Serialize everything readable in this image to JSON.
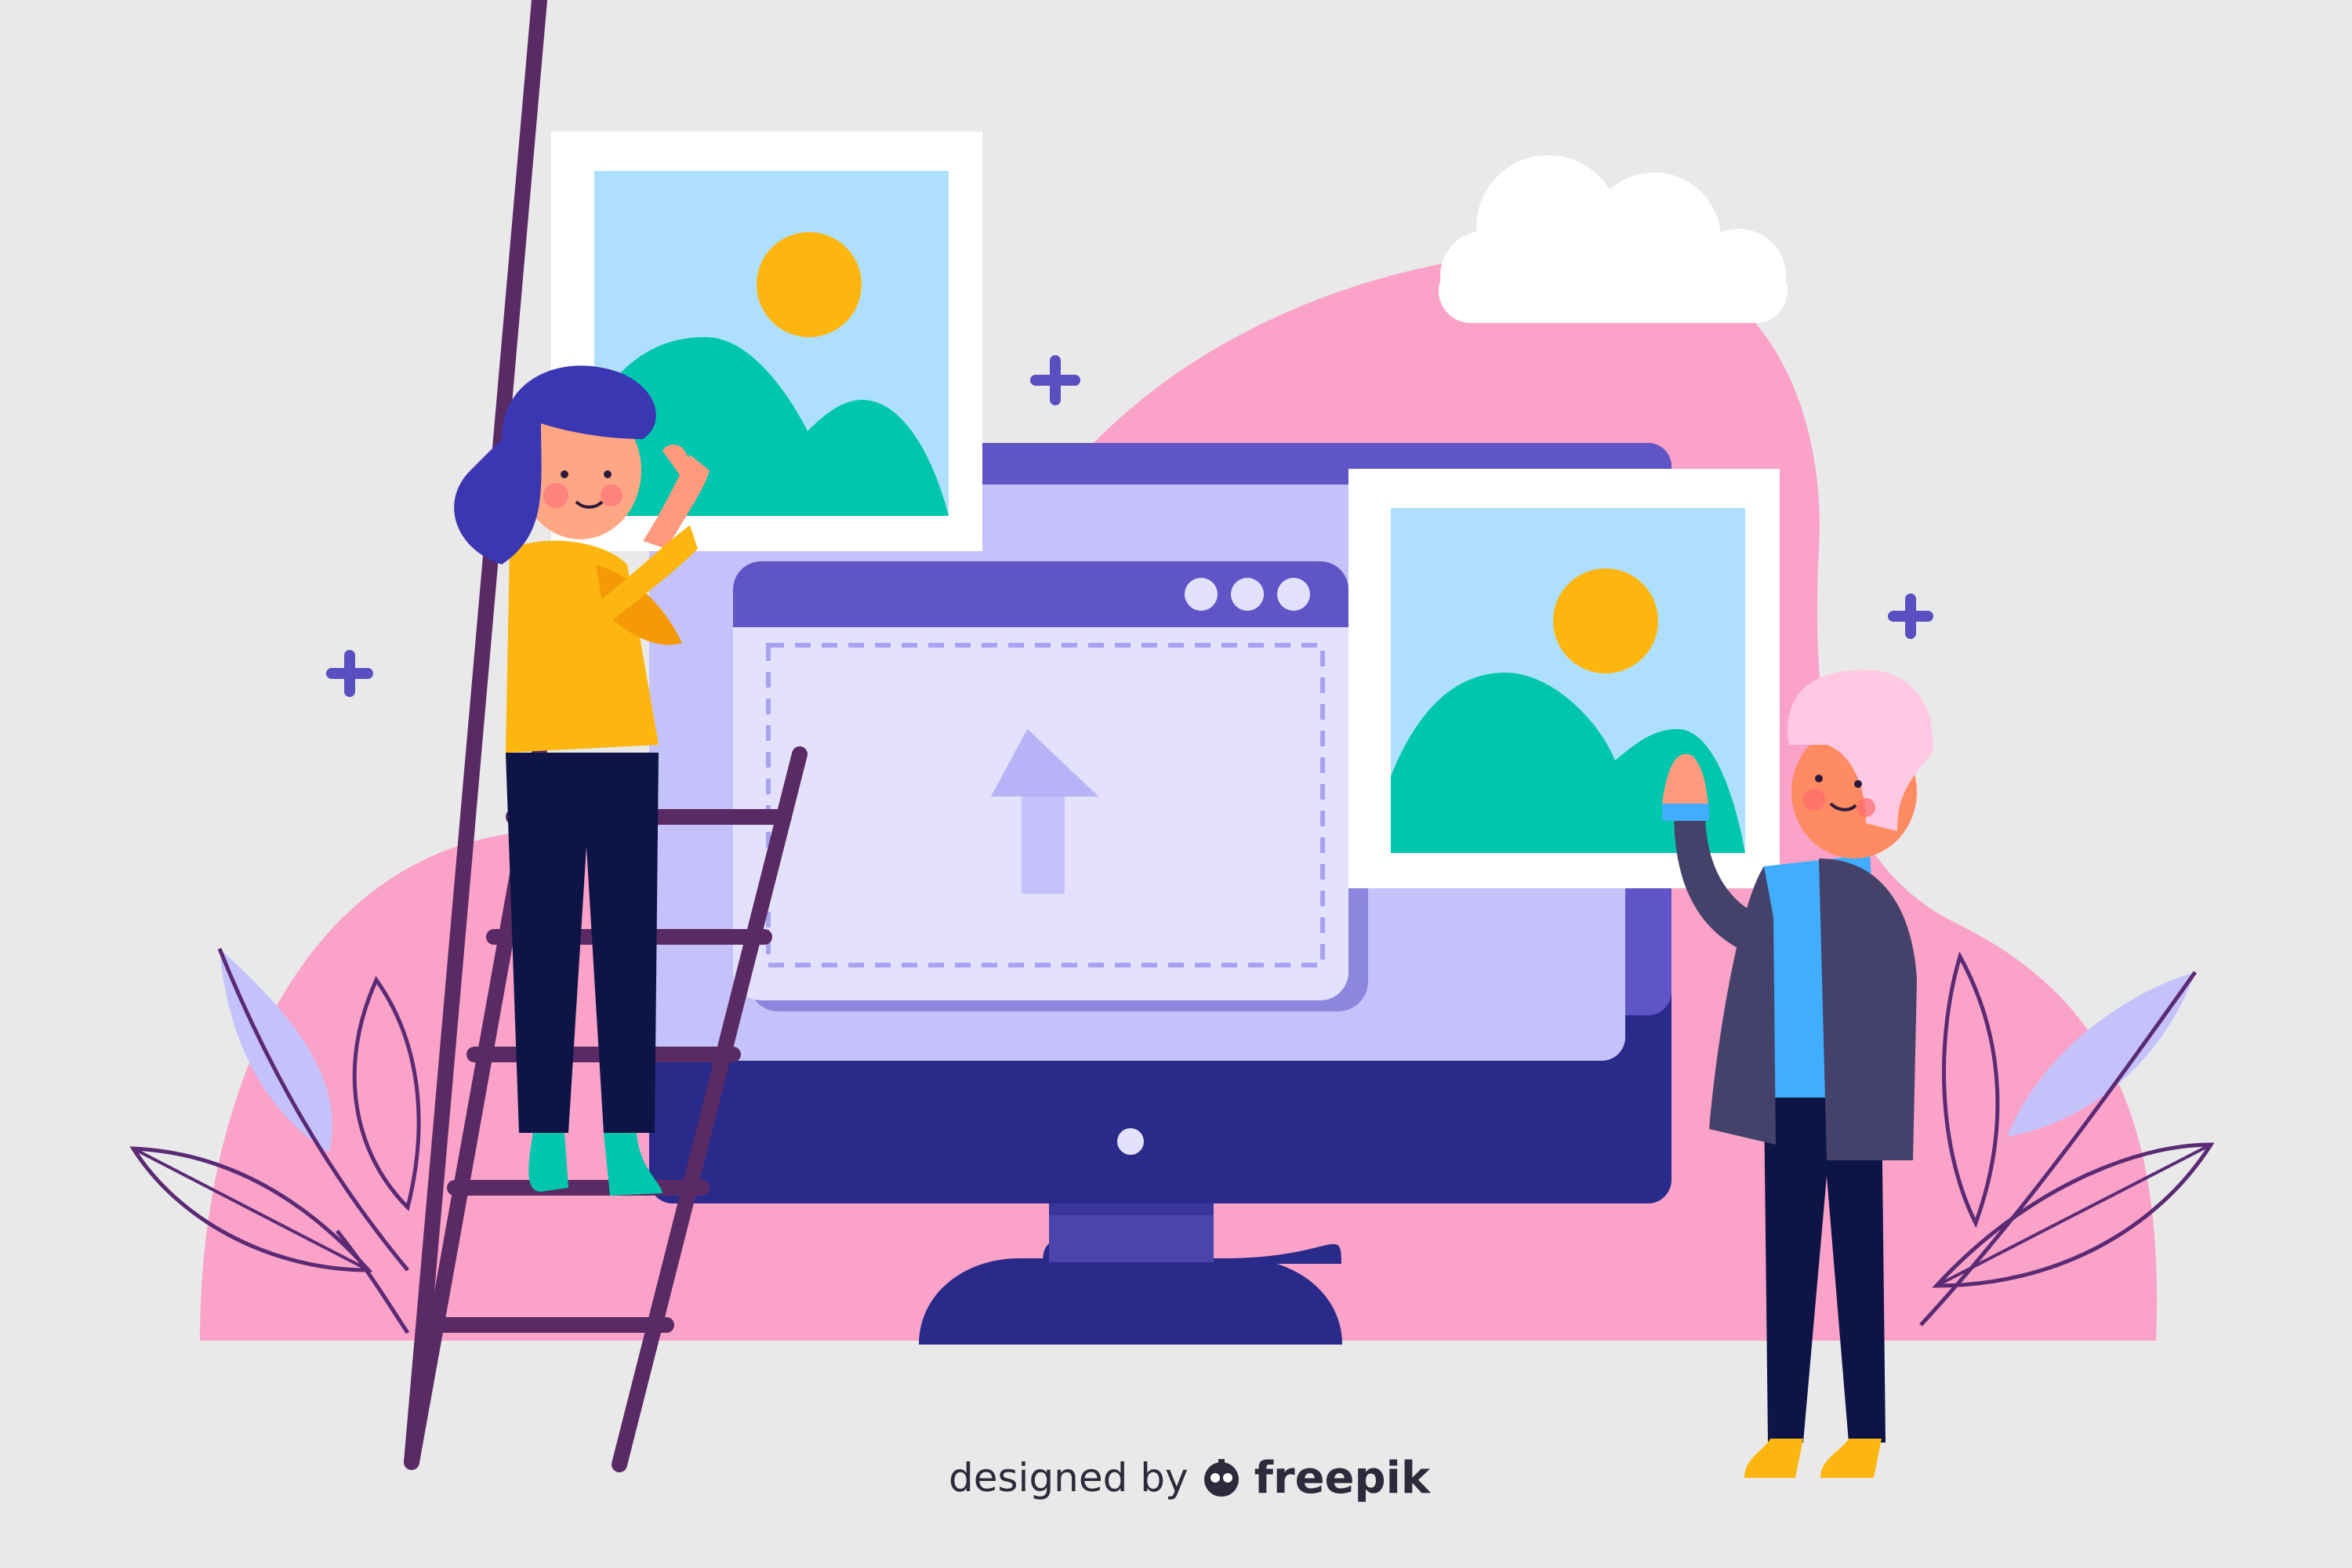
{
  "illustration": {
    "colors": {
      "background": "#e9e9e9",
      "blob_pink": "#fba2c9",
      "monitor_dark": "#292a8a",
      "monitor_screen": "#c5c2fb",
      "window_header": "#5f55c6",
      "window_body": "#e3e1fe",
      "sky": "#aee0fd",
      "sun": "#fdb60f",
      "hill": "#00c6ad",
      "accent_plus": "#5a4fc1"
    },
    "icons": [
      "photo-frame-icon",
      "upload-arrow-icon",
      "cloud-icon",
      "plus-sparkle-icon",
      "leaf-icon"
    ]
  },
  "credit": {
    "prefix": "designed by",
    "brand": "freepik"
  }
}
